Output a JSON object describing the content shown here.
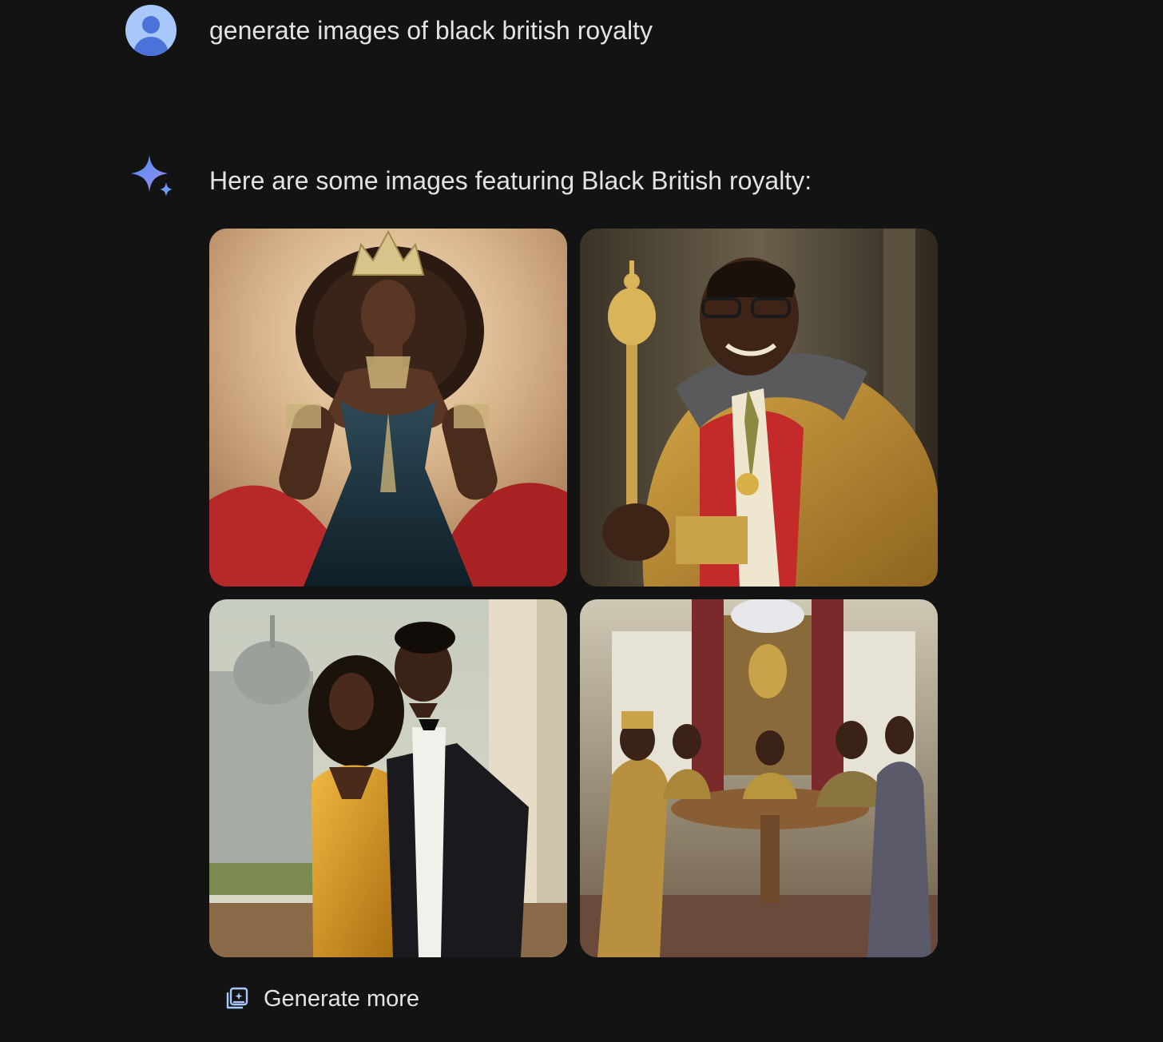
{
  "user_prompt": {
    "avatar_icon": "user-avatar-icon",
    "text": "generate images of black british royalty"
  },
  "response": {
    "icon": "sparkle-icon",
    "text": "Here are some images featuring Black British royalty:",
    "images": [
      {
        "subject": "queen-portrait"
      },
      {
        "subject": "king-with-scepter-portrait"
      },
      {
        "subject": "royal-couple-portrait"
      },
      {
        "subject": "royal-council-scene"
      }
    ]
  },
  "actions": {
    "generate_more_label": "Generate more",
    "generate_more_icon": "image-stack-icon"
  },
  "colors": {
    "background": "#131314",
    "text": "#e3e3e3",
    "avatar": "#a8c7fa",
    "spark_start": "#4f8bf5",
    "spark_end": "#b67fd6"
  }
}
